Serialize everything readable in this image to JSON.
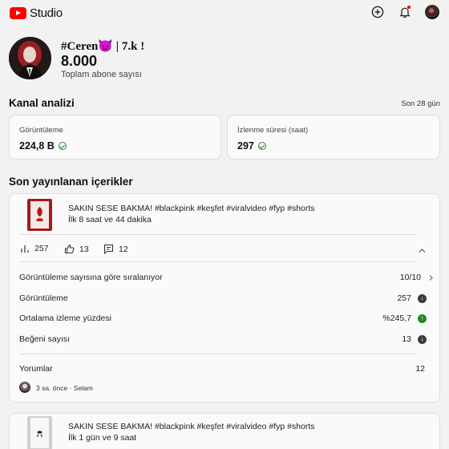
{
  "app": {
    "name": "Studio"
  },
  "channel": {
    "name": "#Ceren😈 | 7.k !",
    "subscribers": "8.000",
    "subscribers_label": "Toplam abone sayısı"
  },
  "analytics": {
    "title": "Kanal analizi",
    "period": "Son 28 gün",
    "views": {
      "label": "Görüntüleme",
      "value": "224,8 B"
    },
    "watch_time": {
      "label": "İzlenme süresi (saat)",
      "value": "297"
    }
  },
  "recent": {
    "title": "Son yayınlanan içerikler",
    "items": [
      {
        "title": "SAKIN SESE BAKMA! #blackpink #keşfet #viralvideo #fyp #shorts",
        "time": "İlk 8 saat ve 44 dakika",
        "views": "257",
        "likes": "13",
        "comments": "12",
        "sort_label": "Görüntüleme sayısına göre sıralanıyor",
        "rank": "10/10",
        "stats": [
          {
            "label": "Görüntüleme",
            "value": "257",
            "trend": "down"
          },
          {
            "label": "Ortalama izleme yüzdesi",
            "value": "%245,7",
            "trend": "up"
          },
          {
            "label": "Beğeni sayısı",
            "value": "13",
            "trend": "down"
          }
        ],
        "comments_label": "Yorumlar",
        "comments_count": "12",
        "latest_comment": "3 sa. önce · Selam"
      },
      {
        "title": "SAKIN SESE BAKMA! #blackpink #keşfet #viralvideo #fyp #shorts",
        "time": "İlk 1 gün ve 9 saat"
      }
    ]
  },
  "colors": {
    "brand_red": "#ff0000",
    "trend_up": "#1e8e1e",
    "trend_down": "#3a3a3a",
    "background": "#f2f2f2"
  },
  "icons": [
    "youtube-logo",
    "create-icon",
    "notifications-icon",
    "account-avatar",
    "check-circle-icon",
    "bar-chart-icon",
    "thumb-up-icon",
    "comment-icon",
    "chevron-up-icon",
    "chevron-right-icon",
    "arrow-down-icon",
    "arrow-up-icon"
  ]
}
